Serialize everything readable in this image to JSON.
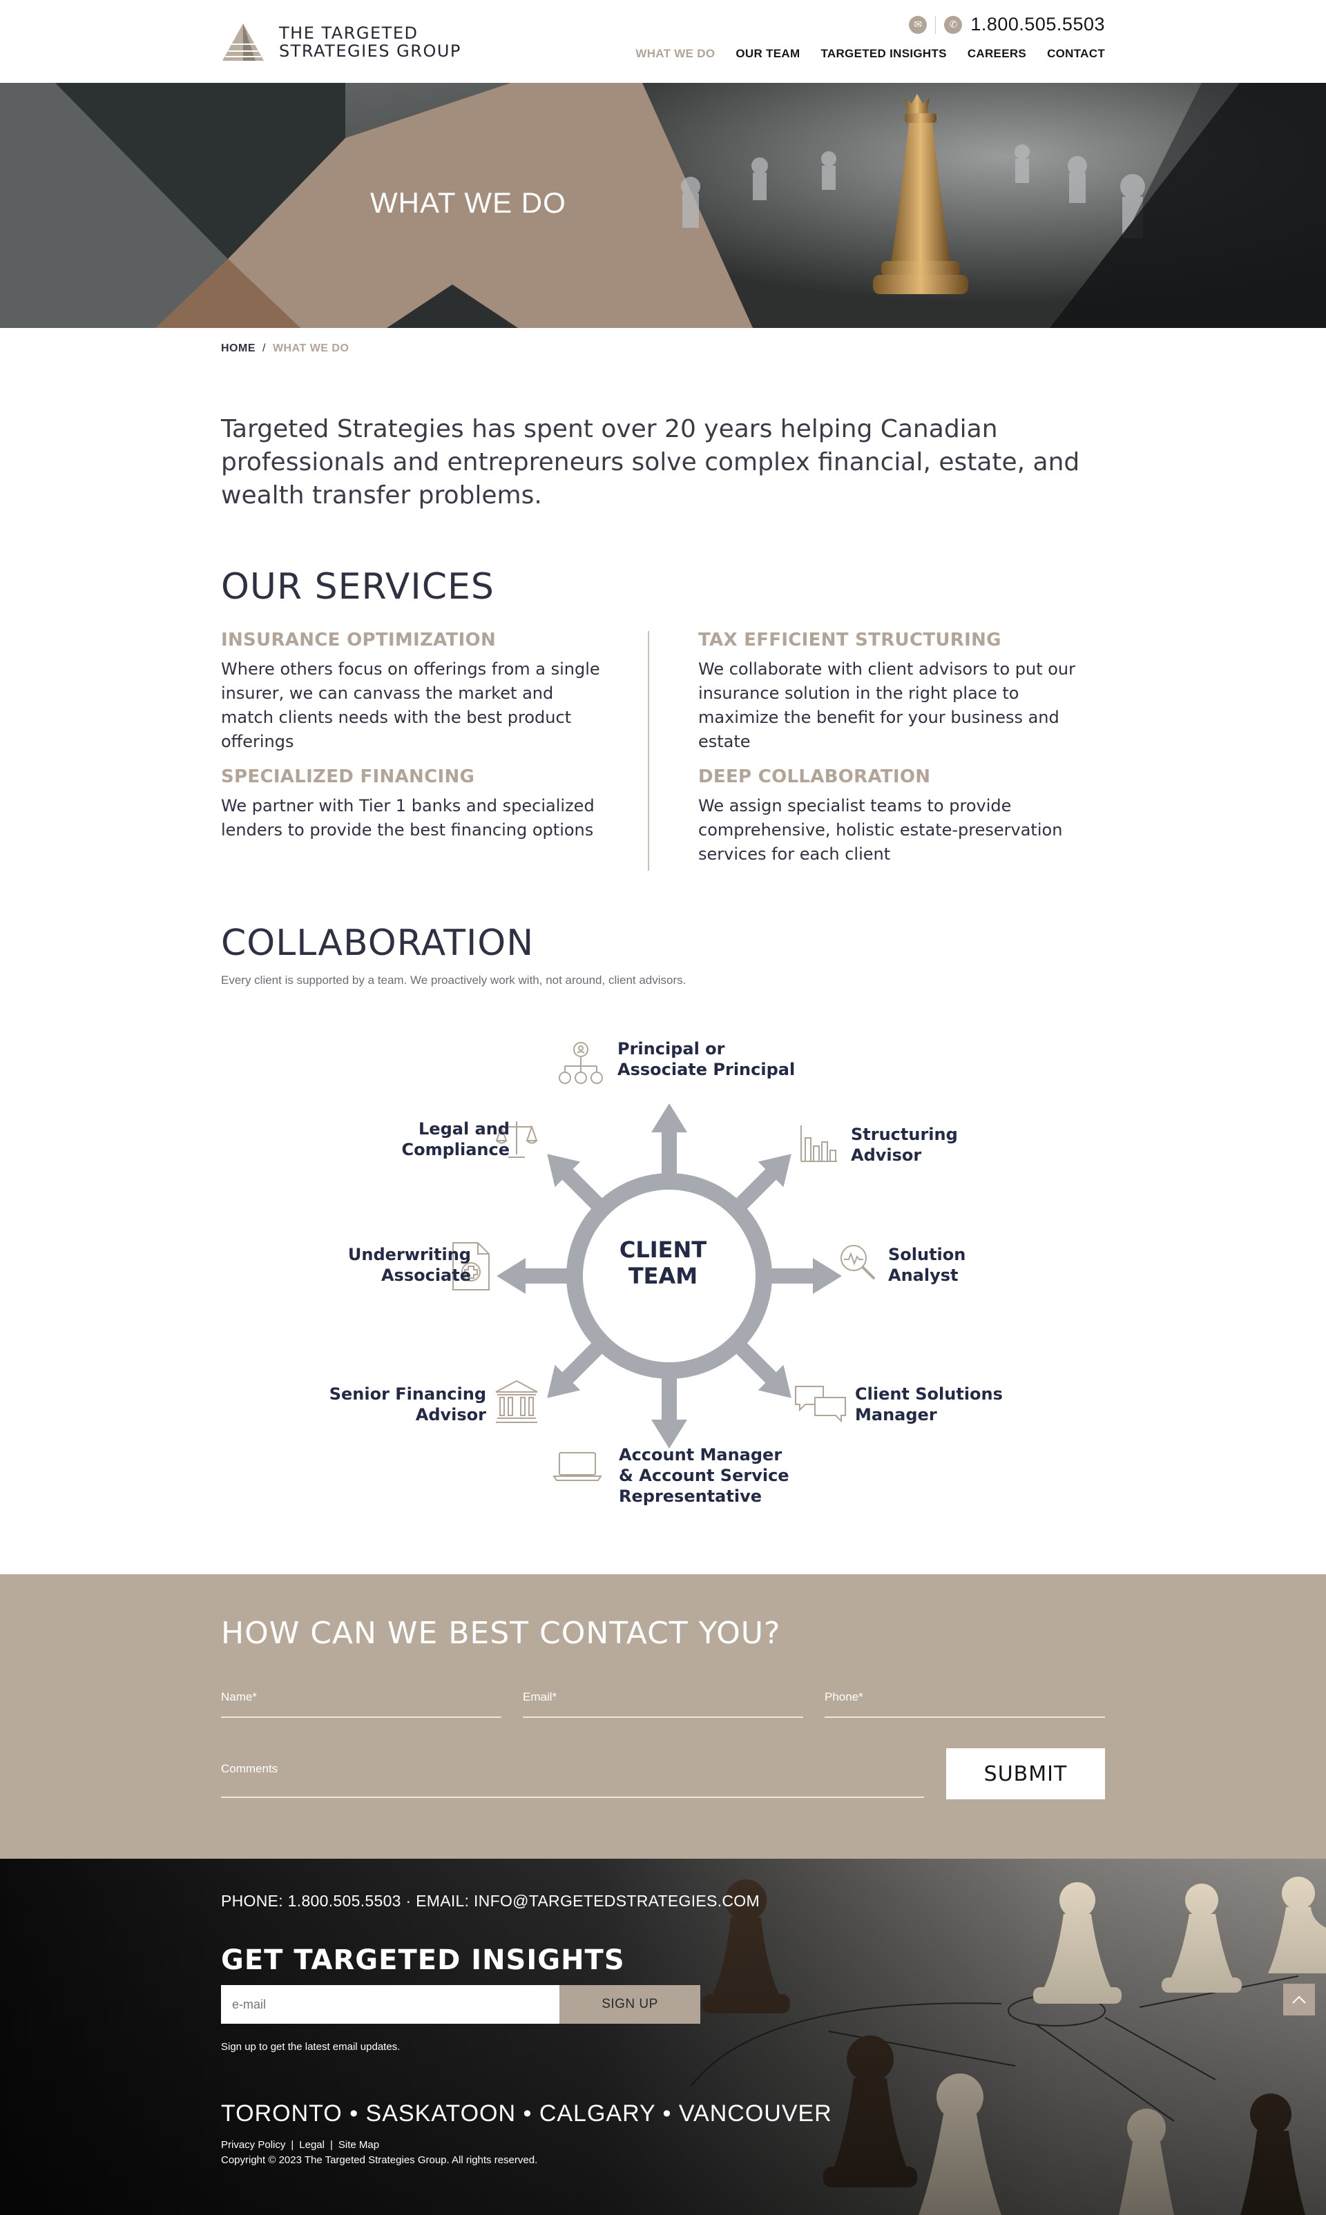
{
  "header": {
    "brand_line1": "THE TARGETED",
    "brand_line2": "STRATEGIES GROUP",
    "phone": "1.800.505.5503",
    "nav": [
      "WHAT WE DO",
      "OUR TEAM",
      "TARGETED INSIGHTS",
      "CAREERS",
      "CONTACT"
    ],
    "active_nav": "WHAT WE DO"
  },
  "hero": {
    "title": "WHAT WE DO"
  },
  "breadcrumb": {
    "home": "HOME",
    "separator": "/",
    "current": "WHAT WE DO"
  },
  "intro": "Targeted Strategies has spent over 20 years helping Canadian professionals and entrepreneurs solve complex financial, estate, and wealth transfer problems.",
  "services": {
    "title": "OUR SERVICES",
    "items": [
      {
        "title": "INSURANCE OPTIMIZATION",
        "text": "Where others focus on offerings from a single insurer, we can canvass the market and match clients needs with the best product offerings"
      },
      {
        "title": "TAX EFFICIENT STRUCTURING",
        "text": "We collaborate with client advisors to put our insurance solution in the right place to maximize the benefit for your business and estate"
      },
      {
        "title": "SPECIALIZED FINANCING",
        "text": "We partner with Tier 1 banks and specialized lenders to provide the best financing options"
      },
      {
        "title": "DEEP COLLABORATION",
        "text": "We assign specialist teams to provide comprehensive, holistic estate-preservation services for each client"
      }
    ]
  },
  "collaboration": {
    "title": "COLLABORATION",
    "subtitle": "Every client is supported by a team. We proactively work with, not around, client advisors.",
    "center": [
      "CLIENT",
      "TEAM"
    ],
    "roles": [
      {
        "line1": "Principal or",
        "line2": "Associate Principal",
        "icon": "org-chart-icon"
      },
      {
        "line1": "Structuring",
        "line2": "Advisor",
        "icon": "bar-chart-icon"
      },
      {
        "line1": "Solution",
        "line2": "Analyst",
        "icon": "magnifier-icon"
      },
      {
        "line1": "Client Solutions",
        "line2": "Manager",
        "icon": "chat-bubbles-icon"
      },
      {
        "line1": "Account Manager",
        "line2": "& Account Service",
        "line3": "Representative",
        "icon": "laptop-icon"
      },
      {
        "line1": "Senior Financing",
        "line2": "Advisor",
        "icon": "bank-icon"
      },
      {
        "line1": "Underwriting",
        "line2": "Associate",
        "icon": "medical-document-icon"
      },
      {
        "line1": "Legal and",
        "line2": "Compliance",
        "icon": "scales-icon"
      }
    ]
  },
  "contact_form": {
    "title": "HOW CAN WE BEST CONTACT YOU?",
    "name_label": "Name*",
    "email_label": "Email*",
    "phone_label": "Phone*",
    "comments_label": "Comments",
    "submit": "SUBMIT"
  },
  "footer": {
    "contact_line": "PHONE: 1.800.505.5503 · EMAIL: INFO@TARGETEDSTRATEGIES.COM",
    "insights_title": "GET TARGETED INSIGHTS",
    "email_placeholder": "e-mail",
    "signup": "SIGN UP",
    "signup_note": "Sign up to get the latest email updates.",
    "cities": "TORONTO • SASKATOON • CALGARY • VANCOUVER",
    "links": [
      "Privacy Policy",
      "Legal",
      "Site Map"
    ],
    "link_separator": "|",
    "copyright": "Copyright © 2023 The Targeted Strategies Group. All rights reserved."
  },
  "colors": {
    "accent": "#b2a597",
    "navy": "#232a45",
    "contact_bg": "#b8aa9b",
    "arrow_gray": "#a7a9b0"
  }
}
